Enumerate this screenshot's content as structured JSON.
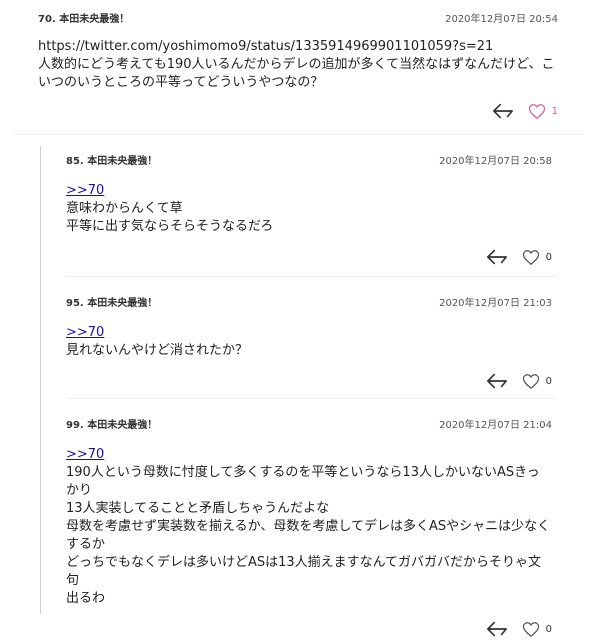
{
  "comments": [
    {
      "name": "70. 本田未央最強！",
      "date": "2020年12月07日 20:54",
      "lines": [
        "https://twitter.com/yoshimomo9/status/1335914969901101059?s=21",
        "人数的にどう考えても190人いるんだからデレの追加が多くて当然なはずなんだけど、こ",
        "いつのいうところの平等ってどういうやつなの？"
      ],
      "like_count": "1",
      "liked": true
    }
  ],
  "replies": [
    {
      "name": "85. 本田未央最強！",
      "date": "2020年12月07日 20:58",
      "anchor": ">>70",
      "lines": [
        "意味わからんくて草",
        "平等に出す気ならそらそうなるだろ"
      ],
      "like_count": "0"
    },
    {
      "name": "95. 本田未央最強！",
      "date": "2020年12月07日 21:03",
      "anchor": ">>70",
      "lines": [
        "見れないんやけど消されたか？"
      ],
      "like_count": "0"
    },
    {
      "name": "99. 本田未央最強！",
      "date": "2020年12月07日 21:04",
      "anchor": ">>70",
      "lines": [
        "190人という母数に忖度して多くするのを平等というなら13人しかいないASきっかり",
        "13人実装してることと矛盾しちゃうんだよな",
        "母数を考慮せず実装数を揃えるか、母数を考慮してデレは多くASやシャニは少なく",
        "するか",
        "どっちでもなくデレは多いけどASは13人揃えますなんてガバガバだからそりゃ文句",
        "出るわ"
      ],
      "like_count": "0"
    }
  ],
  "colors": {
    "heart_liked": "#e4589b",
    "heart": "#555555",
    "link": "#1a0dab"
  },
  "icons": {
    "reply": "reply-arrow-icon",
    "like": "heart-icon"
  }
}
